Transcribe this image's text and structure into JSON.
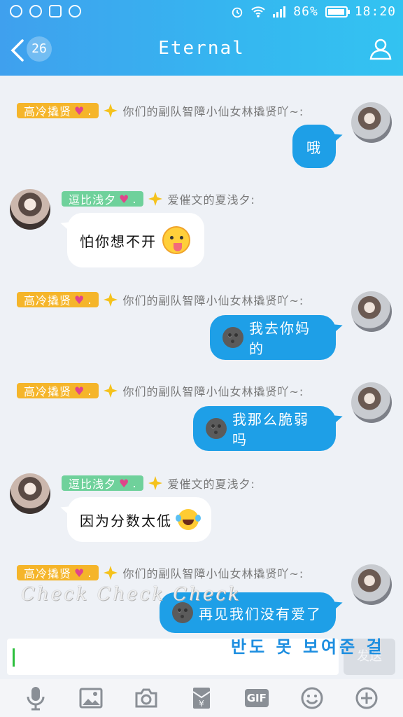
{
  "status_bar": {
    "battery": "86%",
    "time": "18:20"
  },
  "header": {
    "back_count": "26",
    "title": "Eternal"
  },
  "messages": [
    {
      "side": "right",
      "tag": "高冷撬贤",
      "tag_suffix": ".",
      "nick": "你们的副队智障小仙女林撬贤吖~:",
      "text": "哦"
    },
    {
      "side": "left",
      "tag": "逗比浅夕",
      "tag_suffix": ".",
      "nick": "爱催文的夏浅夕:",
      "text": "怕你想不开"
    },
    {
      "side": "right",
      "tag": "高冷撬贤",
      "tag_suffix": ".",
      "nick": "你们的副队智障小仙女林撬贤吖~:",
      "text": "我去你妈的"
    },
    {
      "side": "right",
      "tag": "高冷撬贤",
      "tag_suffix": ".",
      "nick": "你们的副队智障小仙女林撬贤吖~:",
      "text": "我那么脆弱吗"
    },
    {
      "side": "left",
      "tag": "逗比浅夕",
      "tag_suffix": ".",
      "nick": "爱催文的夏浅夕:",
      "text": "因为分数太低"
    },
    {
      "side": "right",
      "tag": "高冷撬贤",
      "tag_suffix": ".",
      "nick": "你们的副队智障小仙女林撬贤吖~:",
      "text": "再见我们没有爱了"
    }
  ],
  "overlay": {
    "watermark": "Check Check Check",
    "caption": "반도 못 보여준 걸"
  },
  "input": {
    "send_label": "发送"
  },
  "toolbar": {
    "gif_label": "GIF"
  },
  "colors": {
    "header": "#3fa0ee",
    "bubble_out": "#1e9fe7",
    "tag_orange": "#f5b52a",
    "tag_green": "#6fd19b"
  }
}
